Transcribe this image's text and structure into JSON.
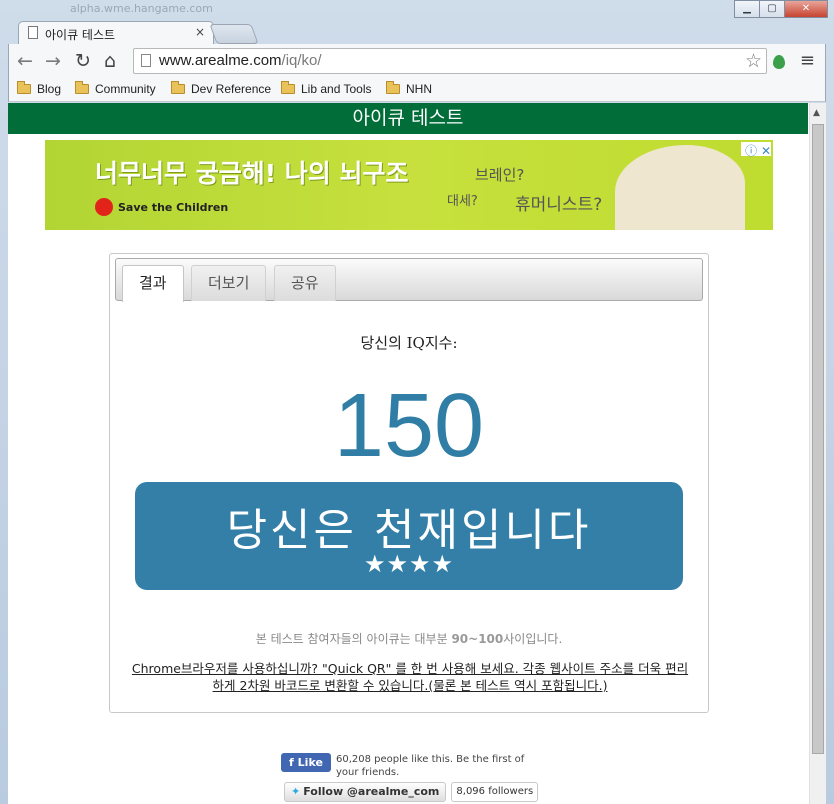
{
  "window": {
    "faded_title": "alpha.wme.hangame.com",
    "minimize": "▁",
    "maximize": "▢",
    "close": "✕"
  },
  "tab": {
    "title": "아이큐 테스트",
    "close": "×"
  },
  "toolbar": {
    "back_icon": "←",
    "forward_icon": "→",
    "reload_icon": "↻",
    "home_icon": "⌂",
    "url_domain": "www.arealme.com",
    "url_path": "/iq/ko/",
    "star_icon": "☆",
    "menu_icon": "≡"
  },
  "bookmarks": [
    "Blog",
    "Community",
    "Dev Reference",
    "Lib and Tools",
    "NHN"
  ],
  "header": {
    "title": "아이큐 테스트"
  },
  "ad": {
    "headline": "너무너무 궁금해! 나의 뇌구조",
    "sub1": "브레인?",
    "sub2": "대세?",
    "sub3": "휴머니스트?",
    "brand": "Save the Children",
    "choices_icon": "ⓘ ✕"
  },
  "quiz": {
    "tabs": [
      "결과",
      "더보기",
      "공유"
    ],
    "score_label": "당신의 IQ지수:",
    "score": "150",
    "result": "당신은 천재입니다",
    "stars": "★★★★",
    "note_prefix": "본 테스트 참여자들의 아이큐는 대부분 ",
    "note_range": "90~100",
    "note_suffix": "사이입니다.",
    "chrome_link": "Chrome브라우저를 사용하십니까? \"Quick QR\" 를 한 번 사용해 보세요. 각종 웹사이트 주소를 더욱 편리하게 2차원 바코드로 변환할 수 있습니다.(물론 본 테스트 역시 포함됩니다.)"
  },
  "social": {
    "fb_like": "Like",
    "fb_text": "60,208 people like this. Be the first of your friends.",
    "tw_follow": "Follow @arealme_com",
    "tw_followers": "8,096 followers"
  },
  "colors": {
    "header_green": "#016d39",
    "result_blue": "#337fa8",
    "score_blue": "#307ea6"
  }
}
